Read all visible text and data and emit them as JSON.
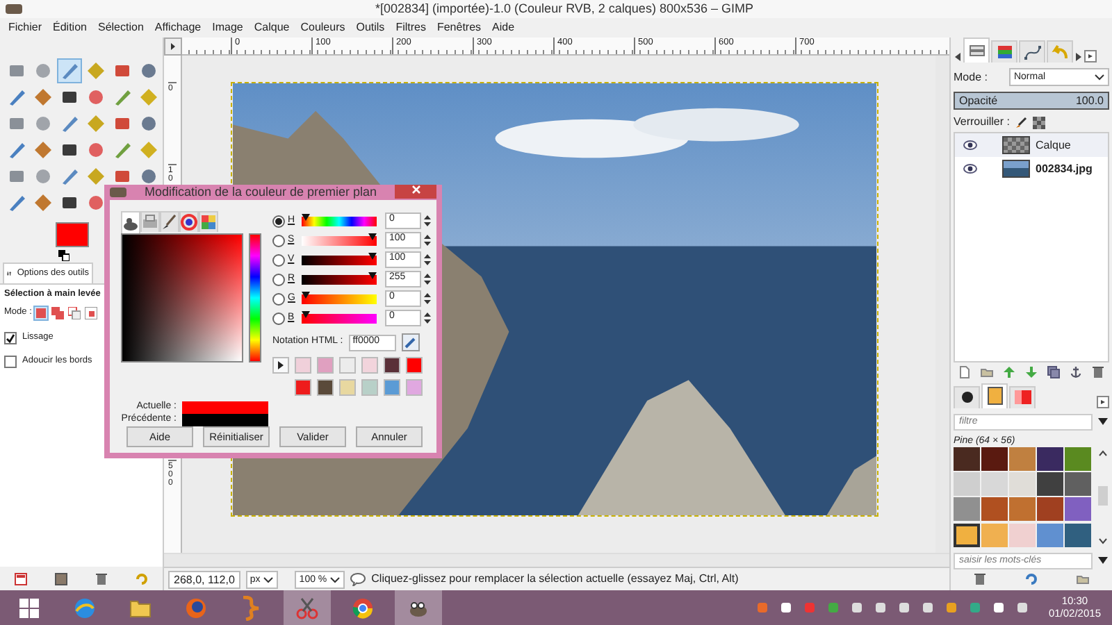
{
  "window": {
    "title": "*[002834] (importée)-1.0 (Couleur RVB, 2 calques) 800x536 – GIMP"
  },
  "menu": [
    "Fichier",
    "Édition",
    "Sélection",
    "Affichage",
    "Image",
    "Calque",
    "Couleurs",
    "Outils",
    "Filtres",
    "Fenêtres",
    "Aide"
  ],
  "toolbox": {
    "tools": [
      {
        "selected": false
      },
      {
        "selected": false
      },
      {
        "selected": true
      },
      {
        "selected": false
      },
      {
        "selected": false
      },
      {
        "selected": false
      },
      {
        "selected": false
      },
      {
        "selected": false
      },
      {
        "selected": false
      },
      {
        "selected": false
      },
      {
        "selected": false
      },
      {
        "selected": false
      },
      {
        "selected": false
      },
      {
        "selected": false
      },
      {
        "selected": false
      },
      {
        "selected": false
      },
      {
        "selected": false
      },
      {
        "selected": false
      },
      {
        "selected": false
      },
      {
        "selected": false
      },
      {
        "selected": false
      },
      {
        "selected": false
      },
      {
        "selected": false
      },
      {
        "selected": false
      },
      {
        "selected": false
      },
      {
        "selected": false
      },
      {
        "selected": false
      },
      {
        "selected": false
      },
      {
        "selected": false
      },
      {
        "selected": false
      },
      {
        "selected": false
      },
      {
        "selected": false
      },
      {
        "selected": false
      },
      {
        "selected": false
      }
    ],
    "foreground": {
      "color": "#ff0000"
    }
  },
  "tool_options": {
    "tab": "Options des outils",
    "title": "Sélection à main levée",
    "mode_label": "Mode :",
    "modes": [
      {
        "selected": true
      },
      {
        "selected": false
      },
      {
        "selected": false
      },
      {
        "selected": false
      }
    ],
    "options": [
      {
        "label": "Lissage",
        "checked": true
      },
      {
        "label": "Adoucir les bords",
        "checked": false
      }
    ]
  },
  "rulers": {
    "horizontal": [
      "0",
      "100",
      "200",
      "300",
      "400",
      "500",
      "600",
      "700"
    ],
    "vertical": [
      "0",
      "10",
      "500"
    ]
  },
  "status": {
    "coords": "268,0, 112,0",
    "unit": "px",
    "zoom": "100 %",
    "message": "Cliquez-glissez pour remplacer la sélection actuelle (essayez Maj, Ctrl, Alt)"
  },
  "layers_panel": {
    "tabs": [
      {
        "selected": true
      },
      {
        "selected": false
      },
      {
        "selected": false
      },
      {
        "selected": false
      }
    ],
    "mode_label": "Mode :",
    "mode": "Normal",
    "opacity": {
      "label": "Opacité",
      "value": "100.0",
      "level": 1
    },
    "lock_label": "Verrouiller :",
    "layers": [
      {
        "name": "Calque",
        "kind": "transparent",
        "visible": true,
        "selected": true
      },
      {
        "name": "002834.jpg",
        "kind": "photo",
        "visible": true,
        "selected": false
      }
    ]
  },
  "patterns_panel": {
    "tabs": [
      {
        "selected": false
      },
      {
        "selected": true
      },
      {
        "selected": false
      }
    ],
    "filter_placeholder": "filtre",
    "caption": "Pine (64 × 56)",
    "patterns": [
      {
        "color": "#4a2a20",
        "selected": false
      },
      {
        "color": "#5a1a10",
        "selected": false
      },
      {
        "color": "#c08040",
        "selected": false
      },
      {
        "color": "#3a2a60",
        "selected": false
      },
      {
        "color": "#5a8a20",
        "selected": false
      },
      {
        "color": "#cfcfcf",
        "selected": false
      },
      {
        "color": "#d8d8d8",
        "selected": false
      },
      {
        "color": "#e0ddd8",
        "selected": false
      },
      {
        "color": "#404040",
        "selected": false
      },
      {
        "color": "#606060",
        "selected": false
      },
      {
        "color": "#909090",
        "selected": false
      },
      {
        "color": "#b05020",
        "selected": false
      },
      {
        "color": "#c07030",
        "selected": false
      },
      {
        "color": "#a04020",
        "selected": false
      },
      {
        "color": "#8060c0",
        "selected": false
      },
      {
        "color": "#f0b040",
        "selected": true
      },
      {
        "color": "#f0b050",
        "selected": false
      },
      {
        "color": "#f0d0d0",
        "selected": false
      },
      {
        "color": "#6090d0",
        "selected": false
      },
      {
        "color": "#306080",
        "selected": false
      }
    ],
    "tags_placeholder": "saisir les mots-clés"
  },
  "color_dialog": {
    "title": "Modification de la couleur de premier plan",
    "selector_tabs": [
      {
        "selected": true
      },
      {
        "selected": false
      },
      {
        "selected": false
      },
      {
        "selected": false
      },
      {
        "selected": false
      }
    ],
    "channels": [
      {
        "label": "H",
        "selected": true,
        "level": 0,
        "value": "0"
      },
      {
        "label": "S",
        "selected": false,
        "level": 1,
        "value": "100"
      },
      {
        "label": "V",
        "selected": false,
        "level": 1,
        "value": "100"
      },
      {
        "label": "R",
        "selected": false,
        "level": 1,
        "value": "255"
      },
      {
        "label": "G",
        "selected": false,
        "level": 0,
        "value": "0"
      },
      {
        "label": "B",
        "selected": false,
        "level": 0,
        "value": "0"
      }
    ],
    "html_label": "Notation HTML :",
    "html_value": "ff0000",
    "history": [
      {
        "color": "#f0d0da"
      },
      {
        "color": "#e0a0c0"
      },
      {
        "color": "#ececec"
      },
      {
        "color": "#f2d4dc"
      },
      {
        "color": "#5a3038"
      },
      {
        "color": "#ff0000"
      },
      {
        "color": "#ee1c1c"
      },
      {
        "color": "#5a4a3a"
      },
      {
        "color": "#e8d8a0"
      },
      {
        "color": "#b8d0c8"
      },
      {
        "color": "#5b9bd5"
      },
      {
        "color": "#e0a8e0"
      }
    ],
    "current": {
      "label": "Actuelle :",
      "color": "#ff0000"
    },
    "previous": {
      "label": "Précédente :",
      "color": "#000000"
    },
    "buttons": [
      "Aide",
      "Réinitialiser",
      "Valider",
      "Annuler"
    ]
  },
  "taskbar": {
    "apps": [
      {
        "selected": false
      },
      {
        "selected": false
      },
      {
        "selected": false
      },
      {
        "selected": false
      },
      {
        "selected": true
      },
      {
        "selected": false
      },
      {
        "selected": true
      }
    ],
    "time": "10:30",
    "date": "01/02/2015"
  }
}
